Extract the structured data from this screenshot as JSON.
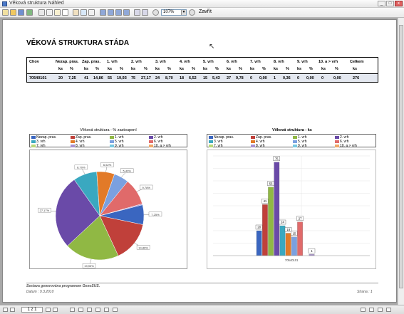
{
  "window": {
    "title": "Věková struktura Náhled",
    "buttons": [
      "_",
      "□",
      "x"
    ]
  },
  "toolbar": {
    "zoom_value": "107%",
    "close_label": "Zavřít",
    "icons": [
      "print-icon",
      "open-icon",
      "save-icon",
      "export-icon",
      "find-icon",
      "copy-icon",
      "page-setup-icon",
      "hand-icon",
      "zoom-icon",
      "first-page-icon",
      "prev-page-icon",
      "next-page-icon",
      "last-page-icon",
      "multipage-icon",
      "one-page-icon",
      "zoom-out-icon",
      "zoom-in-icon"
    ]
  },
  "report": {
    "title": "VĚKOVÁ STRUKTURA STÁDA",
    "table": {
      "headers": [
        "Chov",
        "Nezap. pras.",
        "Zap. pras.",
        "1. vrh",
        "2. vrh",
        "3. vrh",
        "4. vrh",
        "5. vrh",
        "6. vrh",
        "7. vrh",
        "8. vrh",
        "9. vrh",
        "10. a > vrh",
        "Celkem"
      ],
      "subheaders": [
        "ks",
        "%",
        "ks",
        "%",
        "ks",
        "%",
        "ks",
        "%",
        "ks",
        "%",
        "ks",
        "%",
        "ks",
        "%",
        "ks",
        "%",
        "ks",
        "%",
        "ks",
        "%",
        "ks",
        "%",
        "ks",
        "%",
        "ks"
      ],
      "row": [
        "70540101",
        "20",
        "7,25",
        "41",
        "14,86",
        "55",
        "19,93",
        "75",
        "27,17",
        "24",
        "8,70",
        "18",
        "6,52",
        "15",
        "5,43",
        "27",
        "9,78",
        "0",
        "0,00",
        "1",
        "0,36",
        "0",
        "0,00",
        "0",
        "0,00",
        "276"
      ]
    },
    "footer": {
      "left": "Sestava generována programem GenoSUS.",
      "date": "Datum :   9.3.2010",
      "page": "Strana :      1"
    }
  },
  "chart_data": [
    {
      "type": "pie",
      "title": "Věková struktura - % zastoupení",
      "categories": [
        "Nezap. pras.",
        "Zap. pras.",
        "1. vrh",
        "2. vrh",
        "3. vrh",
        "4. vrh",
        "5. vrh",
        "6. vrh",
        "7. vrh",
        "8. vrh",
        "9. vrh",
        "10. a > vrh"
      ],
      "values": [
        7.25,
        14.86,
        19.93,
        27.17,
        8.7,
        6.52,
        5.43,
        9.78,
        0.0,
        0.36,
        0.0,
        0.0
      ],
      "data_labels": [
        "7,25%",
        "14,86%",
        "19,93%",
        "27,17%",
        "8,70%",
        "6,52%",
        "5,43%",
        "9,78%",
        "",
        "",
        "",
        ""
      ],
      "colors": [
        "#3a66c0",
        "#c0403a",
        "#90b844",
        "#6a4aa8",
        "#3aa8c0",
        "#e27a28",
        "#7aa0e0",
        "#e06a6a",
        "#b8d878",
        "#a890d0",
        "#78c8e0",
        "#f0a868"
      ],
      "legend": "top"
    },
    {
      "type": "bar",
      "title": "Věková struktura - ks",
      "categories": [
        "70540101"
      ],
      "series": [
        {
          "name": "Nezap. pras.",
          "values": [
            20
          ]
        },
        {
          "name": "Zap. pras.",
          "values": [
            41
          ]
        },
        {
          "name": "1. vrh",
          "values": [
            55
          ]
        },
        {
          "name": "2. vrh",
          "values": [
            75
          ]
        },
        {
          "name": "3. vrh",
          "values": [
            24
          ]
        },
        {
          "name": "4. vrh",
          "values": [
            18
          ]
        },
        {
          "name": "5. vrh",
          "values": [
            15
          ]
        },
        {
          "name": "6. vrh",
          "values": [
            27
          ]
        },
        {
          "name": "7. vrh",
          "values": [
            0
          ]
        },
        {
          "name": "8. vrh",
          "values": [
            1
          ]
        },
        {
          "name": "9. vrh",
          "values": [
            0
          ]
        },
        {
          "name": "10. a > vrh",
          "values": [
            0
          ]
        }
      ],
      "ylim": [
        0,
        80
      ],
      "grid": true,
      "legend": "top",
      "colors": [
        "#3a66c0",
        "#c0403a",
        "#90b844",
        "#6a4aa8",
        "#3aa8c0",
        "#e27a28",
        "#7aa0e0",
        "#e06a6a",
        "#b8d878",
        "#a890d0",
        "#78c8e0",
        "#f0a868"
      ]
    }
  ],
  "status": {
    "page_indicator": "1 z 1"
  }
}
